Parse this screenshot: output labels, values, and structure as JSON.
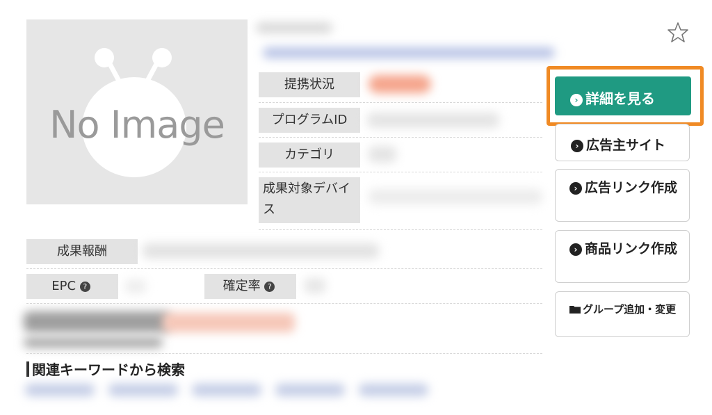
{
  "image_placeholder": {
    "text": "No Image"
  },
  "info": {
    "status_label": "提携状況",
    "program_id_label": "プログラムID",
    "category_label": "カテゴリ",
    "device_label": "成果対象デバイス",
    "reward_label": "成果報酬",
    "epc_label": "EPC",
    "confirm_rate_label": "確定率"
  },
  "actions": {
    "detail": "詳細を見る",
    "advertiser_site": "広告主サイト",
    "ad_link": "広告リンク作成",
    "product_link": "商品リンク作成",
    "group": "グループ追加・変更"
  },
  "keywords": {
    "heading": "関連キーワードから検索"
  },
  "colors": {
    "accent_green": "#1f9a82",
    "highlight_orange": "#f08a24"
  }
}
